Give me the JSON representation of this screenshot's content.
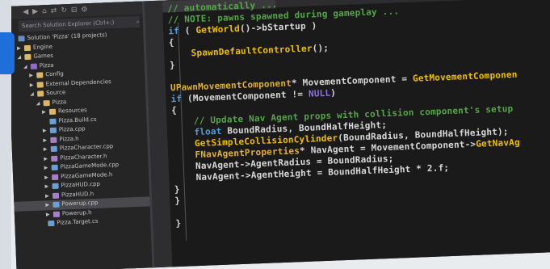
{
  "solution_explorer": {
    "search_placeholder": "Search Solution Explorer (Ctrl+;)",
    "search_shortcut_icon": "search-icon",
    "tree": [
      {
        "label": "Solution 'Pizza' (18 projects)",
        "depth": 0,
        "kind": "sol",
        "toggle": ""
      },
      {
        "label": "Engine",
        "depth": 1,
        "kind": "folder",
        "toggle": "▶"
      },
      {
        "label": "Games",
        "depth": 1,
        "kind": "folder",
        "toggle": "◢"
      },
      {
        "label": "Pizza",
        "depth": 2,
        "kind": "proj",
        "toggle": "◢"
      },
      {
        "label": "Config",
        "depth": 3,
        "kind": "folder",
        "toggle": "▶"
      },
      {
        "label": "External Dependencies",
        "depth": 3,
        "kind": "folder",
        "toggle": "▶"
      },
      {
        "label": "Source",
        "depth": 3,
        "kind": "folder",
        "toggle": "◢"
      },
      {
        "label": "Pizza",
        "depth": 4,
        "kind": "folder",
        "toggle": "◢"
      },
      {
        "label": "Resources",
        "depth": 5,
        "kind": "folder",
        "toggle": "▶"
      },
      {
        "label": "Pizza.Build.cs",
        "depth": 5,
        "kind": "cpp",
        "toggle": ""
      },
      {
        "label": "Pizza.cpp",
        "depth": 5,
        "kind": "cpp",
        "toggle": "▶"
      },
      {
        "label": "Pizza.h",
        "depth": 5,
        "kind": "h",
        "toggle": "▶"
      },
      {
        "label": "PizzaCharacter.cpp",
        "depth": 5,
        "kind": "cpp",
        "toggle": "▶"
      },
      {
        "label": "PizzaCharacter.h",
        "depth": 5,
        "kind": "h",
        "toggle": "▶"
      },
      {
        "label": "PizzaGameMode.cpp",
        "depth": 5,
        "kind": "cpp",
        "toggle": "▶"
      },
      {
        "label": "PizzaGameMode.h",
        "depth": 5,
        "kind": "h",
        "toggle": "▶"
      },
      {
        "label": "PizzaHUD.cpp",
        "depth": 5,
        "kind": "cpp",
        "toggle": "▶"
      },
      {
        "label": "PizzaHUD.h",
        "depth": 5,
        "kind": "h",
        "toggle": "▶"
      },
      {
        "label": "Powerup.cpp",
        "depth": 5,
        "kind": "cpp",
        "toggle": "▶",
        "selected": true
      },
      {
        "label": "Powerup.h",
        "depth": 5,
        "kind": "h",
        "toggle": "▶"
      },
      {
        "label": "Pizza.Target.cs",
        "depth": 4,
        "kind": "cpp",
        "toggle": ""
      }
    ]
  },
  "code": {
    "lines": [
      [
        {
          "c": "t-comment",
          "t": "// automatically ..."
        }
      ],
      [
        {
          "c": "t-comment",
          "t": "// NOTE: pawns spawned during gameplay ..."
        }
      ],
      [
        {
          "c": "t-kw",
          "t": "if"
        },
        {
          "c": "t-id",
          "t": " ( "
        },
        {
          "c": "t-fn",
          "t": "GetWorld"
        },
        {
          "c": "t-id",
          "t": "()->bStartup )"
        }
      ],
      [
        {
          "c": "t-id",
          "t": "{"
        }
      ],
      [
        {
          "c": "t-fn",
          "t": "    SpawnDefaultController"
        },
        {
          "c": "t-id",
          "t": "();"
        }
      ],
      [
        {
          "c": "t-id",
          "t": "}"
        }
      ],
      [
        {
          "c": "t-id",
          "t": ""
        }
      ],
      [
        {
          "c": "t-type",
          "t": "UPawnMovementComponent"
        },
        {
          "c": "t-id",
          "t": "* MovementComponent = "
        },
        {
          "c": "t-fn",
          "t": "GetMovementComponen"
        }
      ],
      [
        {
          "c": "t-kw",
          "t": "if"
        },
        {
          "c": "t-id",
          "t": " (MovementComponent != "
        },
        {
          "c": "t-null",
          "t": "NULL"
        },
        {
          "c": "t-id",
          "t": ")"
        }
      ],
      [
        {
          "c": "t-id",
          "t": "{"
        }
      ],
      [
        {
          "c": "t-comment",
          "t": "    // Update Nav Agent props with collision component's setup"
        }
      ],
      [
        {
          "c": "t-kw",
          "t": "    float"
        },
        {
          "c": "t-id",
          "t": " BoundRadius, BoundHalfHeight;"
        }
      ],
      [
        {
          "c": "t-fn",
          "t": "    GetSimpleCollisionCylinder"
        },
        {
          "c": "t-id",
          "t": "(BoundRadius, BoundHalfHeight);"
        }
      ],
      [
        {
          "c": "t-type",
          "t": "    FNavAgentProperties"
        },
        {
          "c": "t-id",
          "t": "* NavAgent = MovementComponent->"
        },
        {
          "c": "t-fn",
          "t": "GetNavAg"
        }
      ],
      [
        {
          "c": "t-id",
          "t": "    NavAgent->AgentRadius = BoundRadius;"
        }
      ],
      [
        {
          "c": "t-id",
          "t": "    NavAgent->AgentHeight = BoundHalfHeight * 2.f;"
        }
      ],
      [
        {
          "c": "t-id",
          "t": "}"
        }
      ],
      [
        {
          "c": "t-id",
          "t": "}"
        }
      ],
      [
        {
          "c": "t-id",
          "t": ""
        }
      ],
      [
        {
          "c": "t-id",
          "t": "}"
        }
      ]
    ]
  }
}
